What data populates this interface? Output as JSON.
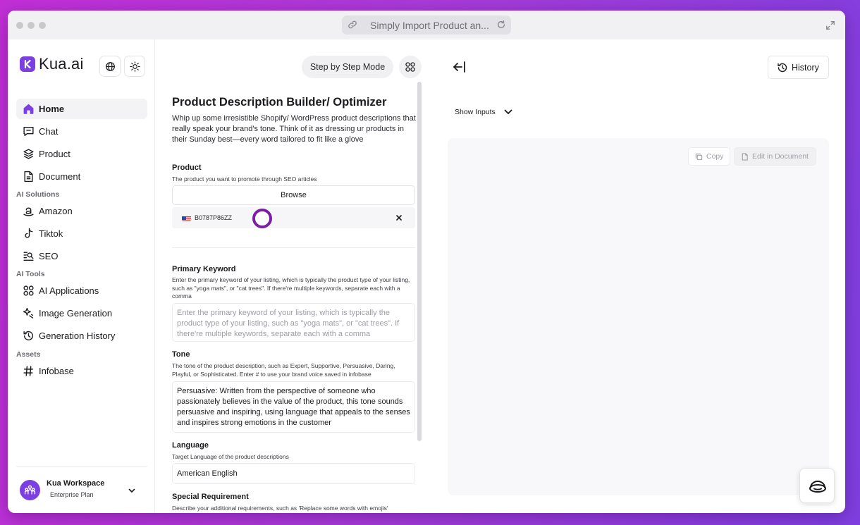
{
  "browser": {
    "url_title": "Simply Import Product an..."
  },
  "sidebar": {
    "brand": "Kua.ai",
    "nav": [
      {
        "label": "Home",
        "icon": "home-icon",
        "active": true
      },
      {
        "label": "Chat",
        "icon": "chat-icon"
      },
      {
        "label": "Product",
        "icon": "layers-icon"
      },
      {
        "label": "Document",
        "icon": "document-icon"
      }
    ],
    "ai_solutions_title": "AI Solutions",
    "ai_solutions": [
      {
        "label": "Amazon",
        "icon": "amazon-icon"
      },
      {
        "label": "Tiktok",
        "icon": "tiktok-icon"
      },
      {
        "label": "SEO",
        "icon": "seo-icon"
      }
    ],
    "ai_tools_title": "AI Tools",
    "ai_tools": [
      {
        "label": "AI Applications",
        "icon": "apps-grid-icon"
      },
      {
        "label": "Image Generation",
        "icon": "image-generation-icon"
      },
      {
        "label": "Generation History",
        "icon": "history-icon"
      }
    ],
    "assets_title": "Assets",
    "assets": [
      {
        "label": "Infobase",
        "icon": "hash-icon"
      }
    ],
    "workspace": {
      "name": "Kua Workspace",
      "plan": "Enterprise Plan"
    }
  },
  "form": {
    "mode_button": "Step by Step Mode",
    "title": "Product Description Builder/ Optimizer",
    "description": "Whip up some irresistible Shopify/ WordPress product descriptions that really speak your brand's tone. Think of it as dressing ur products in their Sunday best—every word tailored to fit like a glove",
    "product": {
      "label": "Product",
      "help": "The product you want to promote through SEO articles",
      "browse": "Browse",
      "asin": "B0787P86ZZ"
    },
    "primary_keyword": {
      "label": "Primary Keyword",
      "help": "Enter the primary keyword of your listing, which is typically the product type of your listing, such as \"yoga mats\", or \"cat trees\". If there're multiple keywords, separate each with a comma",
      "placeholder": "Enter the primary keyword of your listing, which is typically the product type of your listing, such as \"yoga mats\", or \"cat trees\". If there're multiple keywords, separate each with a comma"
    },
    "tone": {
      "label": "Tone",
      "help": "The tone of the product description, such as Expert, Supportive, Persuasive, Daring, Playful, or Sophisticated. Enter # to use your brand voice saved in infobase",
      "value": "Persuasive: Written from the perspective of someone who passionately believes in the value of the product, this tone sounds persuasive and inspiring, using language that appeals to the senses and inspires strong emotions in the customer"
    },
    "language": {
      "label": "Language",
      "help": "Target Language of the product descriptions",
      "value": "American English"
    },
    "special_requirement": {
      "label": "Special Requirement",
      "help": "Describe your additional requirements, such as 'Replace some words with emojis'"
    }
  },
  "output": {
    "history": "History",
    "show_inputs": "Show Inputs",
    "copy": "Copy",
    "edit_in_document": "Edit in Document"
  },
  "colors": {
    "brand": "#7b3fe4",
    "ring": "#7b1fa2"
  }
}
